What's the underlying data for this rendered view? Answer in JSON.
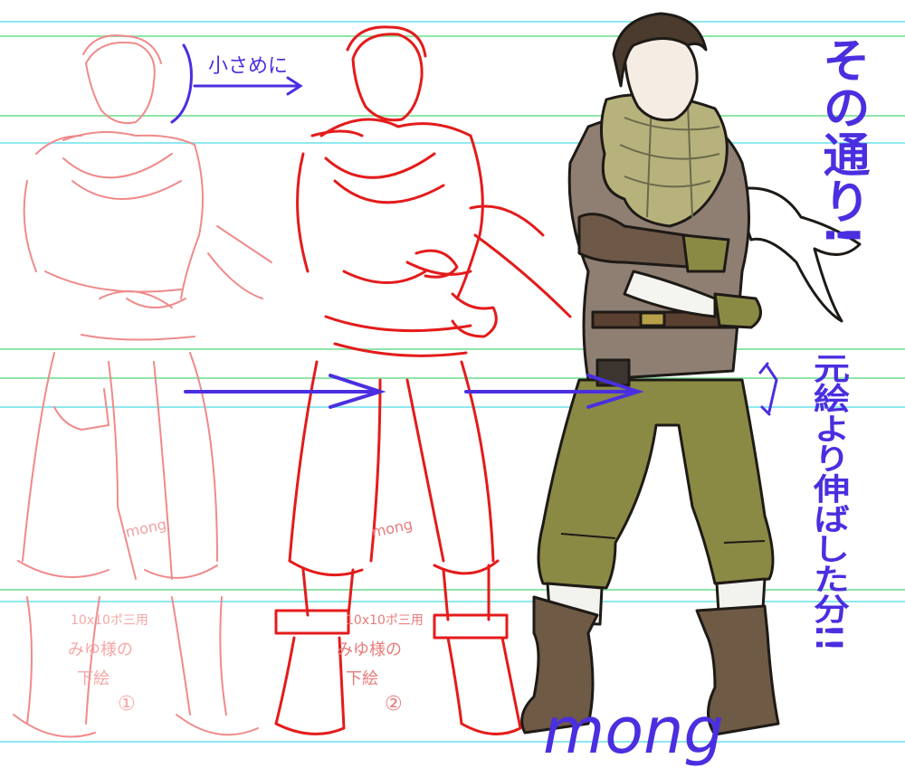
{
  "annotations": {
    "smaller": "小さめに",
    "as_is": "その通り!",
    "extended": "元絵より伸ばした分!!",
    "signature": "mong",
    "sketch_watermark": "mong"
  },
  "sketch_notes": {
    "one": {
      "line1": "10x10ポ三用",
      "line2": "みゆ様の",
      "line3": "下絵",
      "number": "①"
    },
    "two": {
      "line1": "10x10ポ三用",
      "line2": "みゆ様の",
      "line3": "下絵",
      "number": "②"
    }
  },
  "colors": {
    "guide_cyan": "#8ee9ef",
    "guide_green": "#8fe6a8",
    "sketch_red": "#e41b1b",
    "annotation_blue": "#4a2fe0",
    "scarf": "#b7b27c",
    "pants": "#8a8a45",
    "shirt": "#8f7f73",
    "boots": "#6e5a45",
    "hair": "#4a3b2e"
  },
  "icons": [
    "arrow-right-icon",
    "double-arrow-icon"
  ]
}
